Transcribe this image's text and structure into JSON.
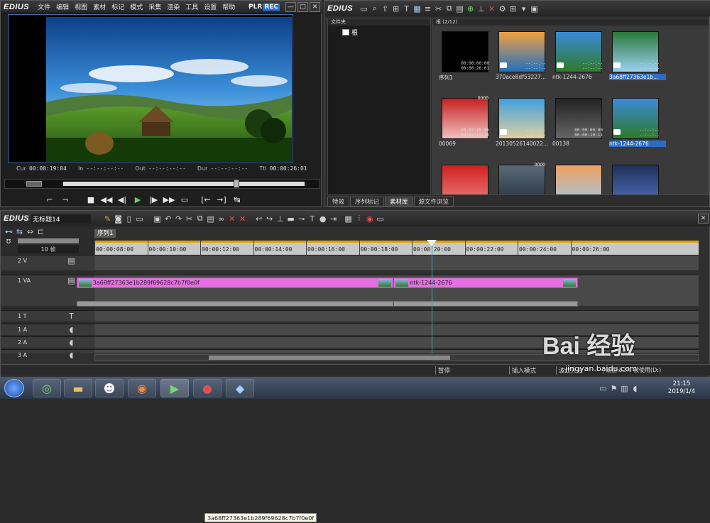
{
  "player": {
    "logo": "EDIUS",
    "menu": [
      "文件",
      "编辑",
      "视图",
      "素材",
      "标记",
      "模式",
      "采集",
      "渲染",
      "工具",
      "设置",
      "帮助"
    ],
    "plr": "PLR",
    "rec": "REC",
    "win_min": "—",
    "win_max": "□",
    "win_close": "✕",
    "timecodes": {
      "cur_label": "Cur",
      "cur": "00:00:19:04",
      "in_label": "In",
      "in": "--:--:--:--",
      "out_label": "Out",
      "out": "--:--:--:--",
      "dur_label": "Dur",
      "dur": "--:--:--:--",
      "ttl_label": "Ttl",
      "ttl": "00:00:26:01"
    },
    "controls": [
      "set-in",
      "set-out",
      "stop",
      "rewind",
      "step-back",
      "play",
      "step-forward",
      "fast-forward",
      "loop",
      "insert",
      "overwrite",
      "replace"
    ]
  },
  "bin": {
    "logo": "EDIUS",
    "folder_header": "文件夹",
    "root_folder": "根",
    "clips_header": "根 (2/12)",
    "clips": [
      {
        "name": "序列1",
        "tc1": "00:00:00:00",
        "tc2": "00:00:26:01",
        "kind": "sequence",
        "selected": false
      },
      {
        "name": "370ace8df53227...",
        "tc1": "--:--:--",
        "tc2": "--:--:--",
        "kind": "photo",
        "selected": false
      },
      {
        "name": "ntk-1244-2676",
        "tc1": "--:--:--",
        "tc2": "--:--:--",
        "kind": "photo",
        "selected": false
      },
      {
        "name": "3a68ff27363e1b...",
        "tc1": "--:--:--",
        "tc2": "--:--:--",
        "kind": "photo",
        "selected": true
      },
      {
        "name": "00069",
        "tc1": "00:07:15:06",
        "tc2": "00:07:27:18",
        "kind": "video",
        "badge": "0000",
        "selected": false
      },
      {
        "name": "20130526140022...",
        "tc1": "--:--:--",
        "tc2": "--:--:--",
        "kind": "photo",
        "selected": false
      },
      {
        "name": "00138",
        "tc1": "00:00:00:00",
        "tc2": "00:00:10:11",
        "kind": "video",
        "selected": false
      },
      {
        "name": "ntk-1244-2676",
        "tc1": "--:--:--",
        "tc2": "--:--:--",
        "kind": "photo",
        "selected": true
      },
      {
        "name": "",
        "kind": "photo",
        "selected": false
      },
      {
        "name": "",
        "kind": "photo",
        "badge": "0000",
        "selected": false
      },
      {
        "name": "",
        "kind": "photo",
        "selected": false
      },
      {
        "name": "",
        "kind": "photo",
        "selected": false
      }
    ],
    "tabs": [
      "特效",
      "序列标记",
      "素材库",
      "源文件浏览"
    ],
    "active_tab": 2
  },
  "timeline": {
    "logo": "EDIUS",
    "project_name": "无标题14",
    "sequence_tab": "序列1",
    "zoom_label": "10 帧",
    "ruler_ticks": [
      "00:00:08:00",
      "00:00:10:00",
      "00:00:12:00",
      "00:00:14:00",
      "00:00:16:00",
      "00:00:18:00",
      "00:00:20:00",
      "00:00:22:00",
      "00:00:24:00",
      "00:00:26:00"
    ],
    "tracks": [
      {
        "label": "2 V",
        "type": "V"
      },
      {
        "label": "1 VA",
        "type": "VA"
      },
      {
        "label": "1 T",
        "type": "T"
      },
      {
        "label": "1 A",
        "type": "A"
      },
      {
        "label": "2 A",
        "type": "A"
      },
      {
        "label": "3 A",
        "type": "A"
      }
    ],
    "clips": [
      {
        "name": "3a68ff27363e1b289f69628c7b7f0e0f",
        "track": "1 VA",
        "start_s": 7.05,
        "end_s": 19.04
      },
      {
        "name": "ntk-1244-2676",
        "track": "1 VA",
        "start_s": 19.04,
        "end_s": 26.01
      }
    ],
    "tooltip": "3a68ff27363e1b289f69628c7b7f0e0f",
    "status": {
      "pause": "暂停",
      "insert_mode": "插入模式",
      "ripple": "波纹开启",
      "disk": "磁盘:52% 被使用(D:)"
    }
  },
  "taskbar": {
    "time": "21:15",
    "date": "2019/1/4",
    "apps": [
      "explorer",
      "qq",
      "firefox",
      "edius",
      "recorder",
      "app"
    ]
  },
  "watermark": {
    "text": "Bai 经验",
    "url": "jingyan.baidu.com"
  },
  "colors": {
    "clip": "#e36fe0",
    "selection": "#2e6bc5",
    "playhead": "#3aa8a8",
    "rec": "#2f6fd6"
  }
}
